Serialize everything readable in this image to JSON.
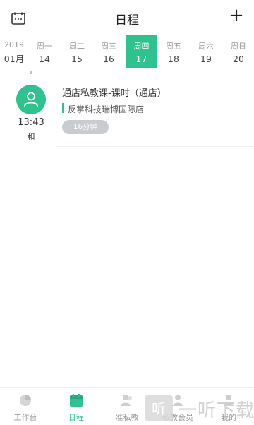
{
  "header": {
    "title": "日程",
    "calendar_icon": "calendar-icon",
    "add_icon": "plus-icon",
    "add_label": "+"
  },
  "week": {
    "year": "2019",
    "month": "01月",
    "days": [
      {
        "weekday": "周一",
        "date": "14"
      },
      {
        "weekday": "周二",
        "date": "15"
      },
      {
        "weekday": "周三",
        "date": "16"
      },
      {
        "weekday": "周四",
        "date": "17",
        "active": true
      },
      {
        "weekday": "周五",
        "date": "18"
      },
      {
        "weekday": "周六",
        "date": "19"
      },
      {
        "weekday": "周日",
        "date": "20"
      }
    ]
  },
  "event": {
    "time": "13:43",
    "who": "和",
    "title": "通店私教课-课时（通店）",
    "location": "反掌科技瑞博国际店",
    "duration": "16分钟",
    "avatar_icon": "person-icon"
  },
  "tabs": [
    {
      "label": "工作台",
      "icon": "pie-chart-icon",
      "active": false
    },
    {
      "label": "日程",
      "icon": "calendar-icon",
      "active": true
    },
    {
      "label": "准私教",
      "icon": "people-icon",
      "active": false
    },
    {
      "label": "私教会员",
      "icon": "member-icon",
      "active": false
    },
    {
      "label": "我的",
      "icon": "user-icon",
      "active": false
    }
  ],
  "watermark": {
    "text": "一听下载",
    "logo_text": "听"
  },
  "colors": {
    "accent": "#2ec28f",
    "muted": "#9a9a9a",
    "badge": "#c7ccd1"
  }
}
